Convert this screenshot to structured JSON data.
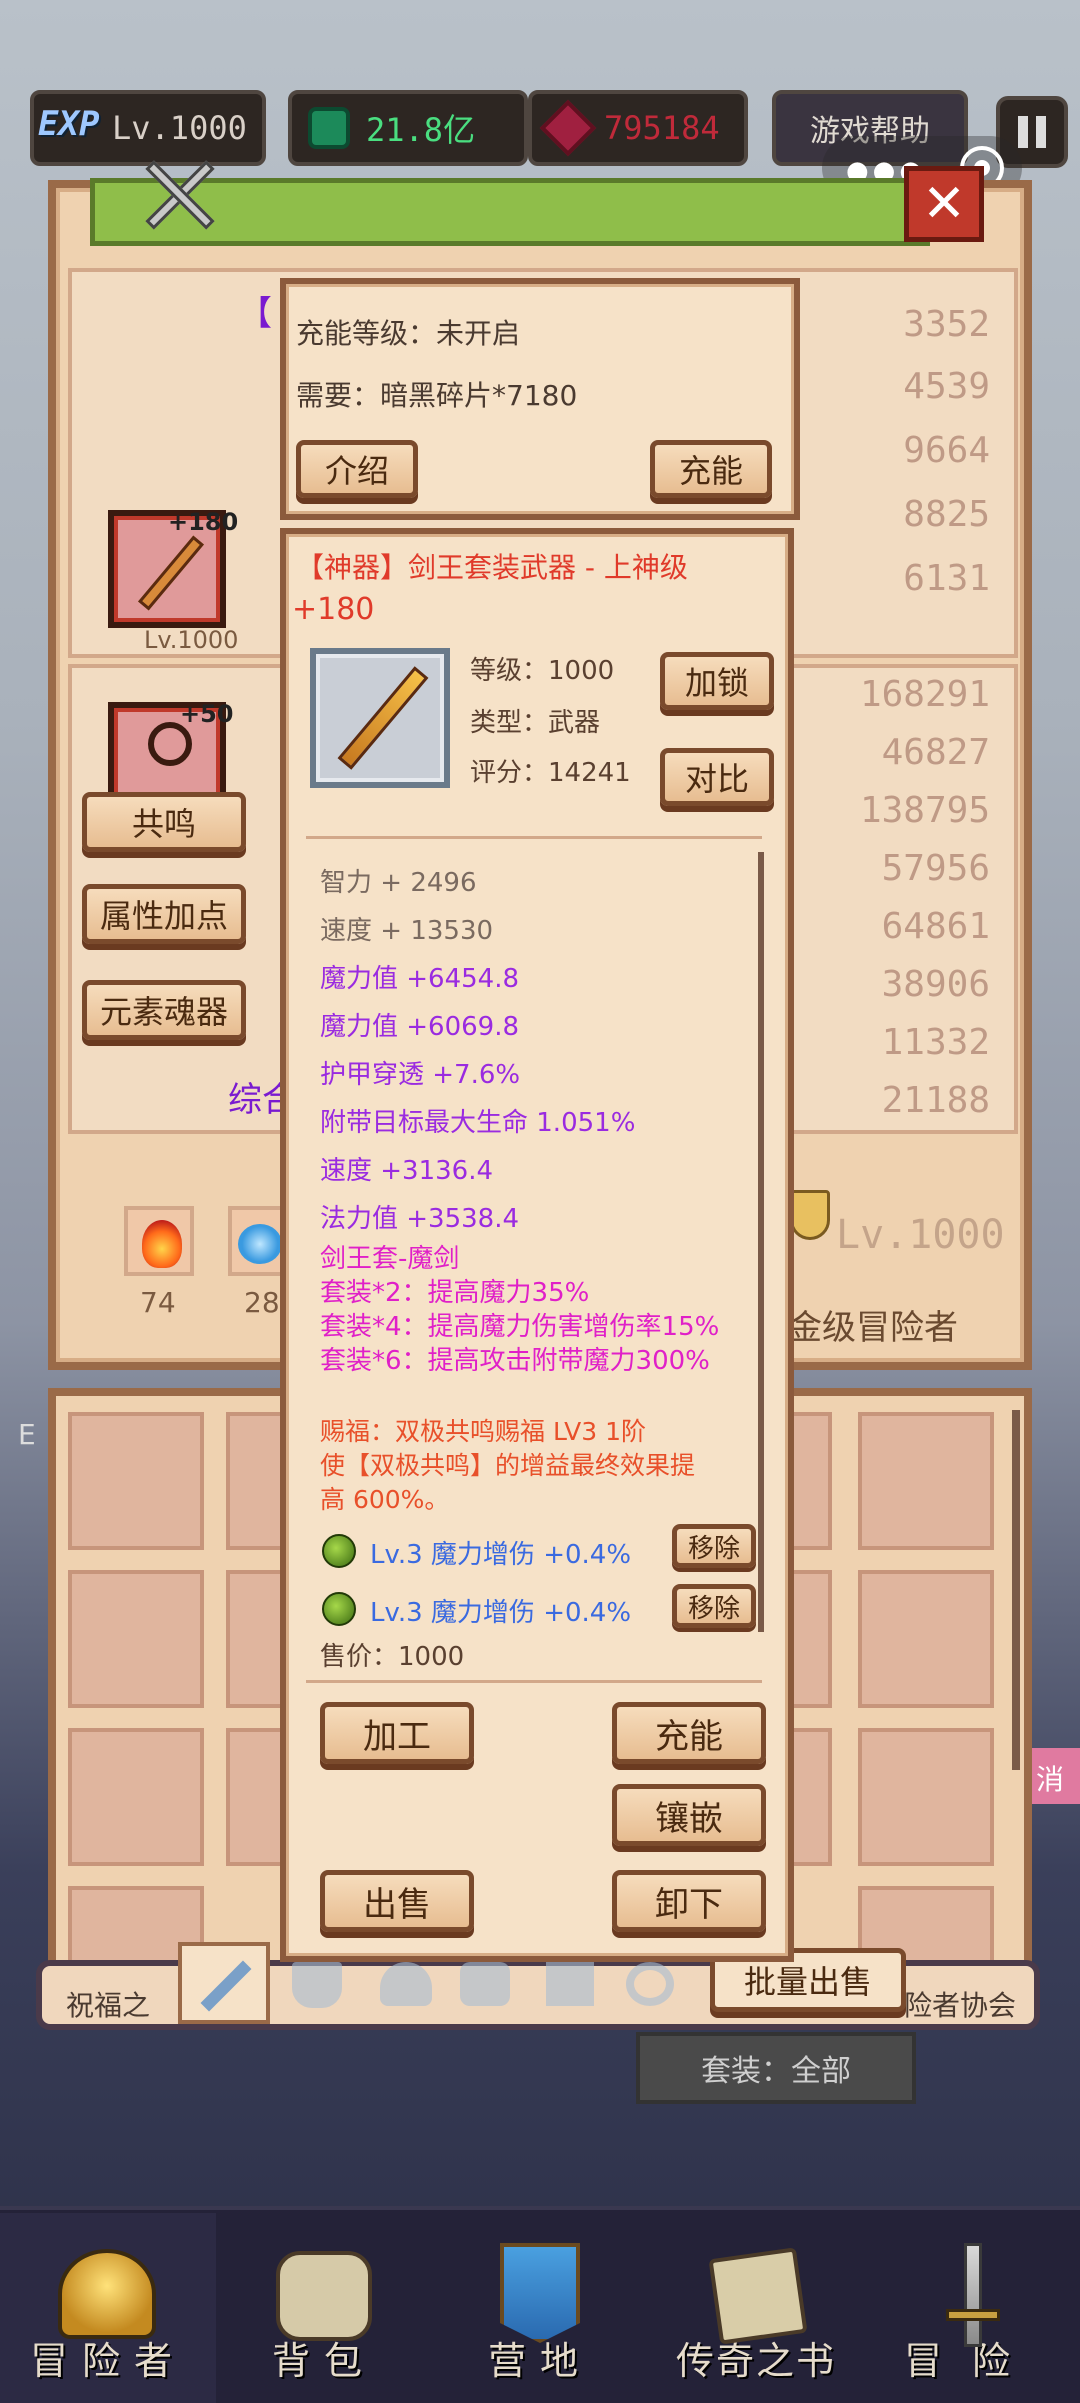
{
  "topbar": {
    "exp_badge": "EXP",
    "level": "Lv.1000",
    "gems": "21.8亿",
    "rubies": "795184",
    "help_button": "游戏帮助"
  },
  "background_panel": {
    "title_fragment": "【",
    "stats_top": [
      "3352",
      "4539",
      "9664",
      "8825",
      "6131"
    ],
    "stats_bottom": [
      "168291",
      "46827",
      "138795",
      "57956",
      "64861",
      "38906",
      "11332",
      "21188"
    ],
    "weapon_slot": {
      "plus": "+180",
      "level": "Lv.1000"
    },
    "ring_slot": {
      "plus": "+50"
    },
    "side_buttons": [
      "共鸣",
      "属性加点",
      "元素魂器"
    ],
    "combined_fragment": "综合",
    "elements": [
      {
        "name": "fire",
        "count": "74"
      },
      {
        "name": "water",
        "count": "28"
      }
    ],
    "player_level": "Lv.1000",
    "player_title": "金级冒险者",
    "footer_left": "祝福之",
    "footer_right": "险者协会",
    "cancel_fragment": "消",
    "exp_fragment": "E"
  },
  "charge_popup": {
    "charge_level_label": "充能等级：未开启",
    "requirement_label": "需要：暗黑碎片*7180",
    "intro_button": "介绍",
    "charge_button": "充能"
  },
  "item_popup": {
    "title": "【神器】剑王套装武器 - 上神级",
    "plus": "+180",
    "level": "等级：1000",
    "type": "类型：武器",
    "score": "评分：14241",
    "lock_button": "加锁",
    "compare_button": "对比",
    "attributes": [
      {
        "text": "智力 + 2496",
        "color": "#7a6a60"
      },
      {
        "text": "速度 + 13530",
        "color": "#7a6a60"
      },
      {
        "text": "魔力值 +6454.8",
        "color": "#9a2be0"
      },
      {
        "text": "魔力值 +6069.8",
        "color": "#9a2be0"
      },
      {
        "text": "护甲穿透 +7.6%",
        "color": "#9a2be0"
      },
      {
        "text": "附带目标最大生命 1.051%",
        "color": "#9a2be0"
      },
      {
        "text": "速度 +3136.4",
        "color": "#9a2be0"
      },
      {
        "text": "法力值 +3538.4",
        "color": "#9a2be0"
      }
    ],
    "set_name": "剑王套-魔剑",
    "set_bonuses": [
      "套装*2：提高魔力35%",
      "套装*4：提高魔力伤害增伤率15%",
      "套装*6：提高攻击附带魔力300%"
    ],
    "blessing_line1": "赐福：双极共鸣赐福 LV3 1阶",
    "blessing_line2": "使【双极共鸣】的增益最终效果提",
    "blessing_line3": "高 600%。",
    "gems": [
      {
        "text": "Lv.3 魔力增伤 +0.4%",
        "remove": "移除"
      },
      {
        "text": "Lv.3 魔力增伤 +0.4%",
        "remove": "移除"
      }
    ],
    "price": "售价：1000",
    "process_button": "加工",
    "charge_button": "充能",
    "inlay_button": "镶嵌",
    "sell_button": "出售",
    "unequip_button": "卸下"
  },
  "inventory": {
    "bulk_sell_button": "批量出售",
    "filter_label": "套装：全部"
  },
  "bottom_nav": [
    {
      "label": "冒险者",
      "icon": "helmet-icon"
    },
    {
      "label": "背包",
      "icon": "backpack-icon"
    },
    {
      "label": "营地",
      "icon": "banner-icon"
    },
    {
      "label": "传奇之书",
      "icon": "book-icon"
    },
    {
      "label": "冒险",
      "icon": "sword-icon"
    }
  ],
  "colors": {
    "item_title": "#e03a2a",
    "attribute_purple": "#9a2be0",
    "set_magenta": "#e020c8",
    "blessing": "#e8502a",
    "gem_blue": "#3a6ae0",
    "gems_green": "#4ade80",
    "rubies_red": "#c02a3a"
  }
}
